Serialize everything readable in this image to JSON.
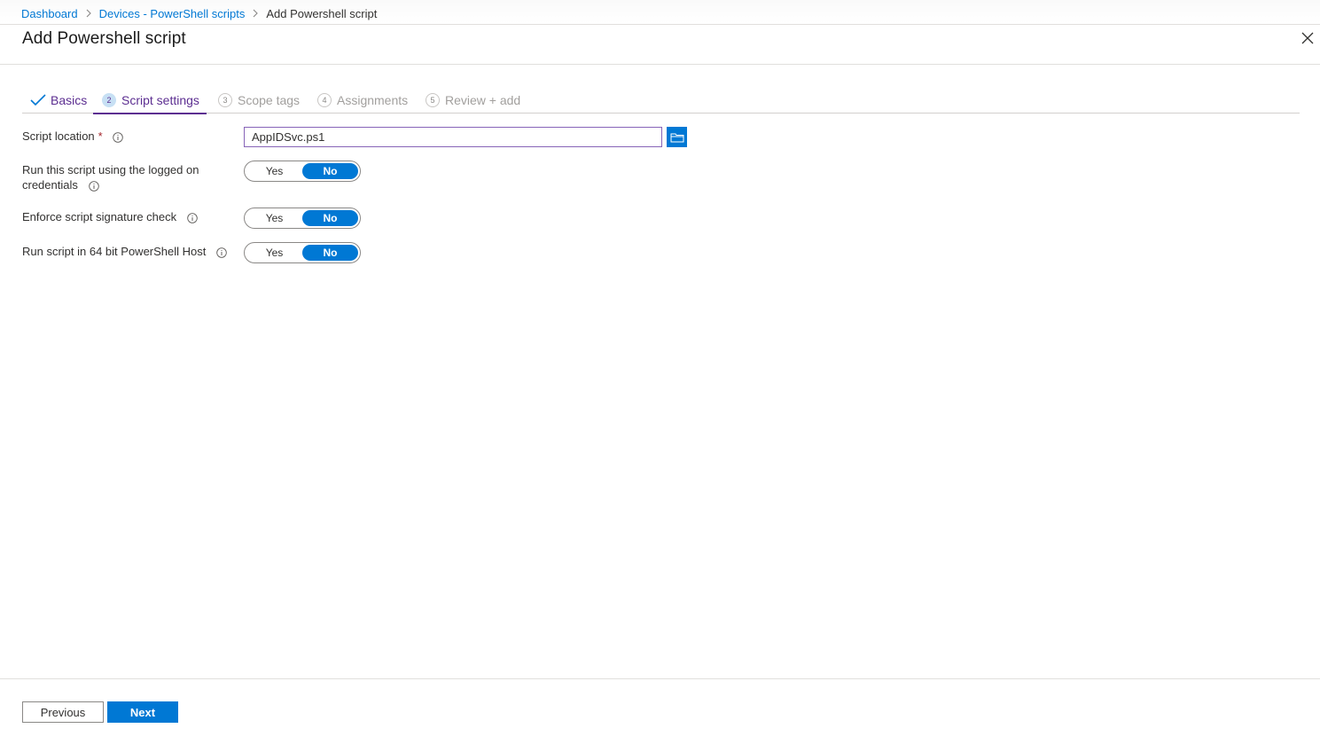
{
  "breadcrumb": {
    "items": [
      "Dashboard",
      "Devices - PowerShell scripts"
    ],
    "current": "Add Powershell script"
  },
  "page": {
    "title": "Add Powershell script"
  },
  "tabs": [
    {
      "label": "Basics",
      "state": "completed"
    },
    {
      "number": "2",
      "label": "Script settings",
      "state": "active"
    },
    {
      "number": "3",
      "label": "Scope tags",
      "state": "disabled"
    },
    {
      "number": "4",
      "label": "Assignments",
      "state": "disabled"
    },
    {
      "number": "5",
      "label": "Review + add",
      "state": "disabled"
    }
  ],
  "form": {
    "script_location": {
      "label": "Script location",
      "required_marker": "*",
      "value": "AppIDSvc.ps1"
    },
    "logged_on": {
      "label_line1": "Run this script using the logged on",
      "label_line2": "credentials",
      "yes": "Yes",
      "no": "No",
      "selected": "No"
    },
    "signature_check": {
      "label": "Enforce script signature check",
      "yes": "Yes",
      "no": "No",
      "selected": "No"
    },
    "bit64": {
      "label": "Run script in 64 bit PowerShell Host",
      "yes": "Yes",
      "no": "No",
      "selected": "No"
    }
  },
  "footer": {
    "previous_label": "Previous",
    "next_label": "Next"
  },
  "icons": {
    "close": "close-icon",
    "browse": "folder-icon",
    "info": "info-icon",
    "check": "checkmark-icon",
    "chevron": "chevron-right-icon"
  },
  "colors": {
    "accent": "#0078d4",
    "active_tab": "#5c2e91",
    "required": "#a4262c"
  }
}
